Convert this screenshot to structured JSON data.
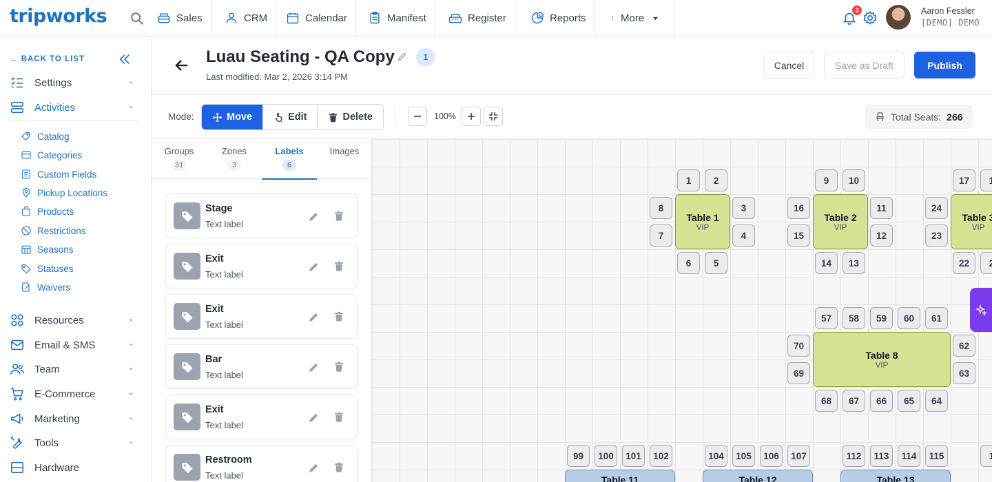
{
  "brand": {
    "logo": "tripworks"
  },
  "nav": {
    "items": [
      {
        "label": "Sales",
        "icon": "register-icon"
      },
      {
        "label": "CRM",
        "icon": "user-icon"
      },
      {
        "label": "Calendar",
        "icon": "calendar-icon"
      },
      {
        "label": "Manifest",
        "icon": "clipboard-icon"
      },
      {
        "label": "Register",
        "icon": "cash-register-icon"
      },
      {
        "label": "Reports",
        "icon": "pie-chart-icon"
      },
      {
        "label": "More",
        "icon": "more-icon"
      }
    ],
    "notification_count": "3",
    "user_name": "Aaron Fessler",
    "user_org": "[DEMO] DEMO"
  },
  "sidebar": {
    "back_label": "← BACK TO LIST",
    "items": [
      {
        "label": "Settings"
      },
      {
        "label": "Activities"
      },
      {
        "label": "Resources"
      },
      {
        "label": "Email & SMS"
      },
      {
        "label": "Team"
      },
      {
        "label": "E-Commerce"
      },
      {
        "label": "Marketing"
      },
      {
        "label": "Tools"
      },
      {
        "label": "Hardware"
      }
    ],
    "sub_items": [
      {
        "label": "Catalog"
      },
      {
        "label": "Categories"
      },
      {
        "label": "Custom Fields"
      },
      {
        "label": "Pickup Locations"
      },
      {
        "label": "Products"
      },
      {
        "label": "Restrictions"
      },
      {
        "label": "Seasons"
      },
      {
        "label": "Statuses"
      },
      {
        "label": "Waivers"
      }
    ]
  },
  "header": {
    "title": "Luau Seating - QA Copy",
    "version": "1",
    "last_modified": "Last modified: Mar 2, 2026 3:14 PM",
    "cancel_label": "Cancel",
    "draft_label": "Save as Draft",
    "publish_label": "Publish"
  },
  "toolbar": {
    "mode_label": "Mode:",
    "modes": [
      {
        "label": "Move"
      },
      {
        "label": "Edit"
      },
      {
        "label": "Delete"
      }
    ],
    "zoom": "100%",
    "total_seats_label": "Total Seats:",
    "total_seats": "266"
  },
  "panel": {
    "tabs": [
      {
        "label": "Groups",
        "count": "31"
      },
      {
        "label": "Zones",
        "count": "3"
      },
      {
        "label": "Labels",
        "count": "6"
      },
      {
        "label": "Images",
        "count": ""
      }
    ],
    "labels": [
      {
        "name": "Stage",
        "type": "Text label"
      },
      {
        "name": "Exit",
        "type": "Text label"
      },
      {
        "name": "Exit",
        "type": "Text label"
      },
      {
        "name": "Bar",
        "type": "Text label"
      },
      {
        "name": "Exit",
        "type": "Text label"
      },
      {
        "name": "Restroom",
        "type": "Text label"
      }
    ]
  },
  "canvas": {
    "tables": [
      {
        "name": "Table 1",
        "tag": "VIP"
      },
      {
        "name": "Table 2",
        "tag": "VIP"
      },
      {
        "name": "Table 3",
        "tag": "VIP"
      },
      {
        "name": "Table 8",
        "tag": "VIP"
      },
      {
        "name": "Table 11",
        "tag": ""
      },
      {
        "name": "Table 12",
        "tag": ""
      },
      {
        "name": "Table 13",
        "tag": ""
      }
    ],
    "seats": [
      "1",
      "2",
      "8",
      "3",
      "7",
      "4",
      "6",
      "5",
      "9",
      "10",
      "16",
      "11",
      "15",
      "12",
      "14",
      "13",
      "17",
      "1",
      "24",
      "23",
      "22",
      "2",
      "57",
      "58",
      "59",
      "60",
      "61",
      "70",
      "62",
      "69",
      "63",
      "68",
      "67",
      "66",
      "65",
      "64",
      "99",
      "100",
      "101",
      "102",
      "104",
      "105",
      "106",
      "107",
      "112",
      "113",
      "114",
      "115",
      "1"
    ]
  },
  "colors": {
    "accent": "#1d62e3",
    "vip_table": "#d8e294",
    "table_blue": "#b7cde3",
    "ai_button": "#7c3aed"
  }
}
